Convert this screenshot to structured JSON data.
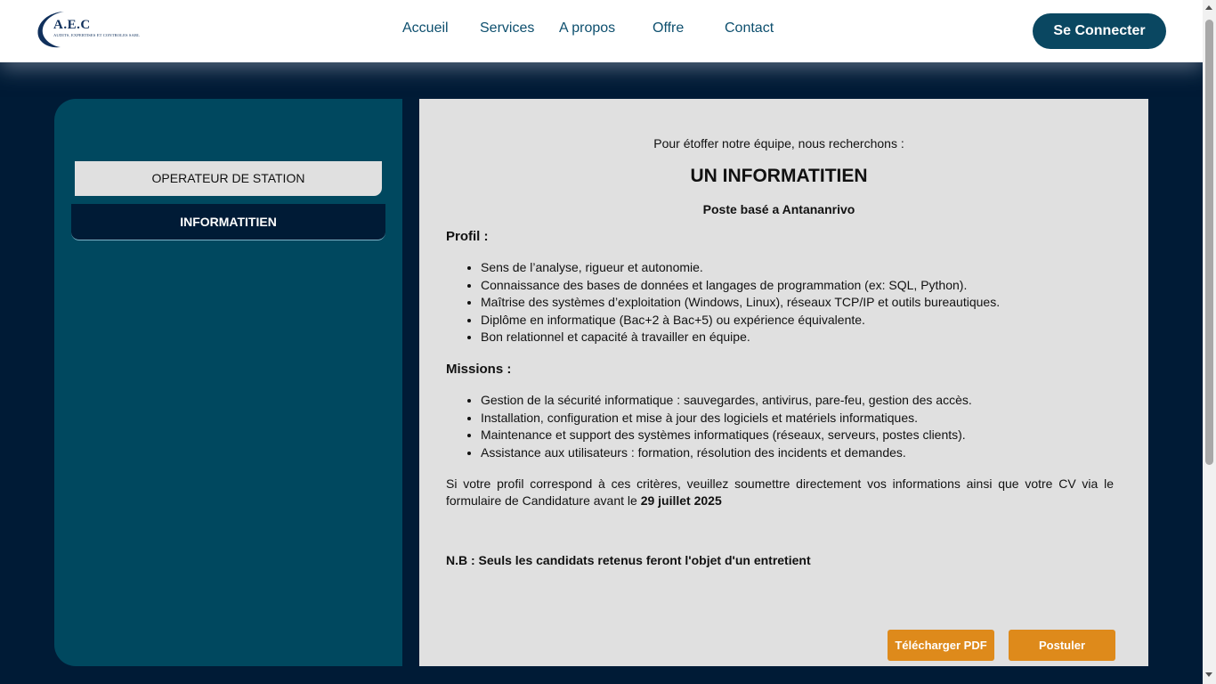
{
  "header": {
    "logo": {
      "title": "A.E.C",
      "subtitle": "AUDITS, EXPERTISES ET CONTROLES SARL"
    },
    "nav": [
      "Accueil",
      "Services",
      "A propos",
      "Offre",
      "Contact"
    ],
    "connect_label": "Se Connecter"
  },
  "sidebar": {
    "items": [
      {
        "label": "OPERATEUR DE STATION",
        "active": false
      },
      {
        "label": "INFORMATITIEN",
        "active": true
      }
    ]
  },
  "offer": {
    "intro": "Pour étoffer notre équipe, nous recherchons :",
    "title": "UN INFORMATITIEN",
    "location": "Poste basé a Antananrivo",
    "profile_heading": "Profil :",
    "profile_items": [
      "Sens de l’analyse, rigueur et autonomie.",
      "Connaissance des bases de données et langages de programmation (ex: SQL, Python).",
      "Maîtrise des systèmes d’exploitation (Windows, Linux), réseaux TCP/IP et outils bureautiques.",
      "Diplôme en informatique (Bac+2 à Bac+5) ou expérience équivalente.",
      "Bon relationnel et capacité à travailler en équipe."
    ],
    "missions_heading": "Missions :",
    "mission_items": [
      "Gestion de la sécurité informatique : sauvegardes, antivirus, pare-feu, gestion des accès.",
      "Installation, configuration et mise à jour des logiciels et matériels informatiques.",
      "Maintenance et support des systèmes informatiques (réseaux, serveurs, postes clients).",
      "Assistance aux utilisateurs : formation, résolution des incidents et demandes."
    ],
    "closing_text": "Si votre profil correspond à ces critères, veuillez soumettre directement vos informations ainsi que votre CV via le formulaire de Candidature avant le ",
    "deadline": "29 juillet 2025",
    "note": "N.B : Seuls les candidats retenus feront l'objet d'un entretient",
    "download_label": "Télécharger PDF",
    "apply_label": "Postuler"
  },
  "colors": {
    "navy": "#001b36",
    "teal": "#00485f",
    "button_dark": "#0a4761",
    "accent_orange": "#de8a1b",
    "panel_gray": "#e0e0e0"
  }
}
